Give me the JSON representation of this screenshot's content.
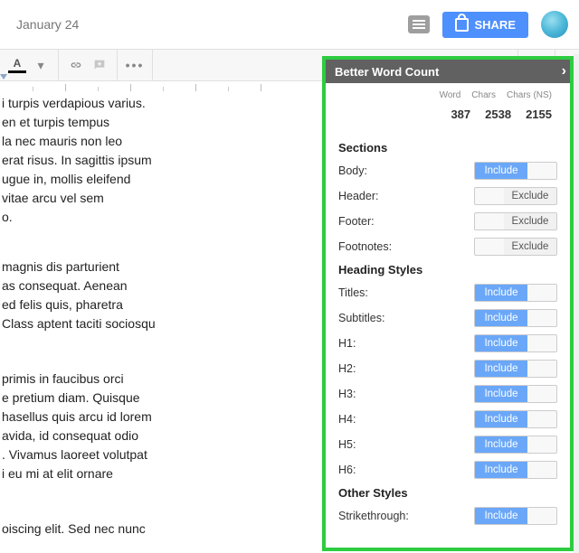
{
  "header": {
    "last_edit": "January 24",
    "share_label": "SHARE"
  },
  "toolbar": {
    "text_color_letter": "A",
    "more": "•••"
  },
  "doc_lines_group1": [
    "i turpis verdapious varius.",
    "en et turpis tempus",
    "la nec mauris non leo",
    "erat risus. In sagittis ipsum",
    "ugue in, mollis eleifend",
    "vitae arcu vel sem",
    "o."
  ],
  "doc_lines_group2": [
    "magnis dis parturient",
    "as consequat. Aenean",
    "ed felis quis, pharetra",
    "Class aptent taciti sociosqu"
  ],
  "doc_lines_group3": [
    "primis in faucibus orci",
    "e pretium diam. Quisque",
    "hasellus quis arcu id lorem",
    "avida, id consequat odio",
    ". Vivamus laoreet volutpat",
    "i eu mi at elit ornare"
  ],
  "doc_lines_group4": [
    "oiscing elit. Sed nec nunc"
  ],
  "panel": {
    "title": "Better Word Count",
    "counts": {
      "col_word": "Word",
      "col_chars": "Chars",
      "col_chars_ns": "Chars (NS)",
      "word": "387",
      "chars": "2538",
      "chars_ns": "2155"
    },
    "sections_title": "Sections",
    "sections": [
      {
        "label": "Body:",
        "state": "include",
        "text": "Include"
      },
      {
        "label": "Header:",
        "state": "exclude",
        "text": "Exclude"
      },
      {
        "label": "Footer:",
        "state": "exclude",
        "text": "Exclude"
      },
      {
        "label": "Footnotes:",
        "state": "exclude",
        "text": "Exclude"
      }
    ],
    "heading_styles_title": "Heading Styles",
    "heading_styles": [
      {
        "label": "Titles:",
        "state": "include",
        "text": "Include"
      },
      {
        "label": "Subtitles:",
        "state": "include",
        "text": "Include"
      },
      {
        "label": "H1:",
        "state": "include",
        "text": "Include"
      },
      {
        "label": "H2:",
        "state": "include",
        "text": "Include"
      },
      {
        "label": "H3:",
        "state": "include",
        "text": "Include"
      },
      {
        "label": "H4:",
        "state": "include",
        "text": "Include"
      },
      {
        "label": "H5:",
        "state": "include",
        "text": "Include"
      },
      {
        "label": "H6:",
        "state": "include",
        "text": "Include"
      }
    ],
    "other_styles_title": "Other Styles",
    "other_styles": [
      {
        "label": "Strikethrough:",
        "state": "include",
        "text": "Include"
      }
    ]
  }
}
